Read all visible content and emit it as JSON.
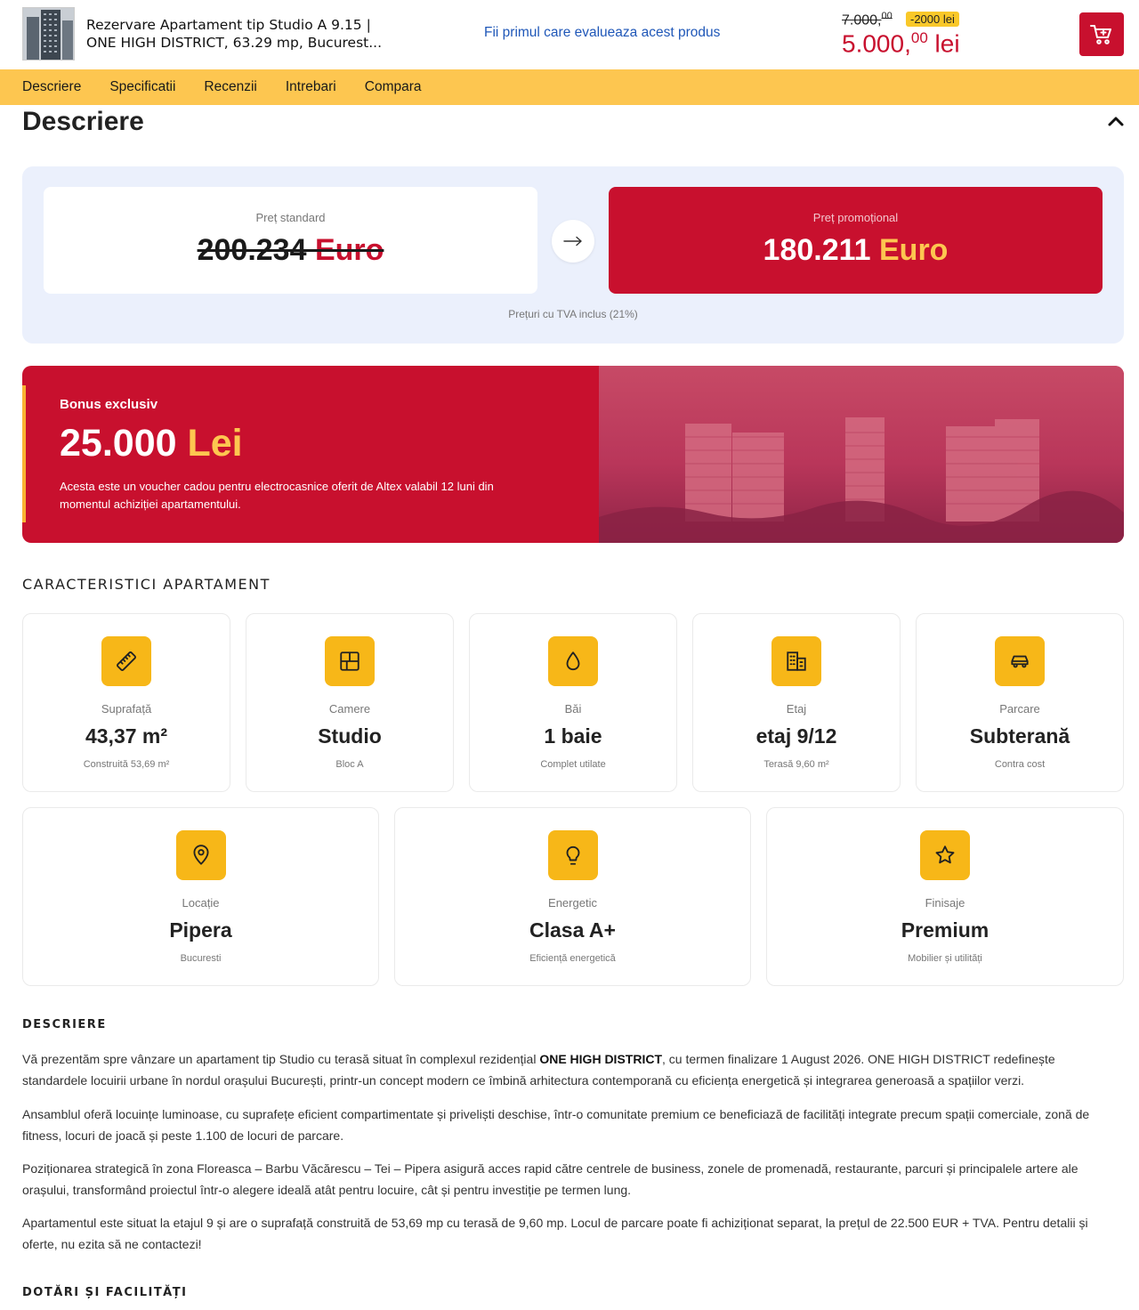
{
  "header": {
    "title_line1": "Rezervare Apartament tip Studio A 9.15 |",
    "title_line2": "ONE HIGH DISTRICT, 63.29 mp, Bucurest...",
    "review_link": "Fii primul care evalueaza acest produs",
    "old_price_int": "7.000,",
    "old_price_dec": "00",
    "discount": "-2000 lei",
    "new_price_int": "5.000,",
    "new_price_dec": "00",
    "new_price_cur": " lei"
  },
  "tabs": [
    "Descriere",
    "Specificatii",
    "Recenzii",
    "Intrebari",
    "Compara"
  ],
  "section_title": "Descriere",
  "price_compare": {
    "standard_label": "Preț standard",
    "standard_value": "200.234",
    "standard_currency": " Euro",
    "promo_label": "Preț promoțional",
    "promo_value": "180.211",
    "promo_currency": " Euro",
    "vat_note": "Prețuri cu TVA inclus (21%)"
  },
  "bonus": {
    "label": "Bonus exclusiv",
    "value": "25.000",
    "currency": " Lei",
    "text": "Acesta este un voucher cadou pentru electrocasnice oferit de Altex valabil 12 luni din momentul achiziției apartamentului."
  },
  "features": {
    "heading": "CARACTERISTICI APARTAMENT",
    "row1": [
      {
        "icon": "ruler-icon",
        "label": "Suprafață",
        "value": "43,37 m²",
        "sub": "Construită 53,69 m²"
      },
      {
        "icon": "layout-icon",
        "label": "Camere",
        "value": "Studio",
        "sub": "Bloc A"
      },
      {
        "icon": "drop-icon",
        "label": "Băi",
        "value": "1 baie",
        "sub": "Complet utilate"
      },
      {
        "icon": "building-icon",
        "label": "Etaj",
        "value": "etaj 9/12",
        "sub": "Terasă 9,60 m²"
      },
      {
        "icon": "car-icon",
        "label": "Parcare",
        "value": "Subterană",
        "sub": "Contra cost"
      }
    ],
    "row2": [
      {
        "icon": "map-pin-icon",
        "label": "Locație",
        "value": "Pipera",
        "sub": "Bucuresti"
      },
      {
        "icon": "lightbulb-icon",
        "label": "Energetic",
        "value": "Clasa A+",
        "sub": "Eficiență energetică"
      },
      {
        "icon": "star-icon",
        "label": "Finisaje",
        "value": "Premium",
        "sub": "Mobilier și utilități"
      }
    ]
  },
  "description": {
    "heading": "DESCRIERE",
    "p1_before": "Vă prezentăm spre vânzare un apartament tip Studio cu terasă situat în complexul rezidențial ",
    "p1_bold": "ONE HIGH DISTRICT",
    "p1_after": ", cu termen finalizare 1 August 2026. ONE HIGH DISTRICT redefinește standardele locuirii urbane în nordul orașului București, printr-un concept modern ce îmbină arhitectura contemporană cu eficiența energetică și integrarea generoasă a spațiilor verzi.",
    "p2": "Ansamblul oferă locuințe luminoase, cu suprafețe eficient compartimentate și priveliști deschise, într-o comunitate premium ce beneficiază de facilități integrate precum spații comerciale, zonă de fitness, locuri de joacă și peste 1.100 de locuri de parcare.",
    "p3": "Poziționarea strategică în zona Floreasca – Barbu Văcărescu – Tei – Pipera asigură acces rapid către centrele de business, zonele de promenadă, restaurante, parcuri și principalele artere ale orașului, transformând proiectul într-o alegere ideală atât pentru locuire, cât și pentru investiție pe termen lung.",
    "p4": "Apartamentul este situat la etajul 9 și are o suprafață construită de 53,69 mp cu terasă de 9,60 mp. Locul de parcare poate fi achiziționat separat, la prețul de 22.500 EUR + TVA. Pentru detalii și oferte, nu ezita să ne contactezi!",
    "facilities_heading": "DOTĂRI ȘI FACILITĂȚI"
  },
  "colors": {
    "brand_red": "#c8102e",
    "accent_yellow": "#fdc650",
    "icon_yellow": "#f7b718",
    "link_blue": "#1f57b8"
  }
}
